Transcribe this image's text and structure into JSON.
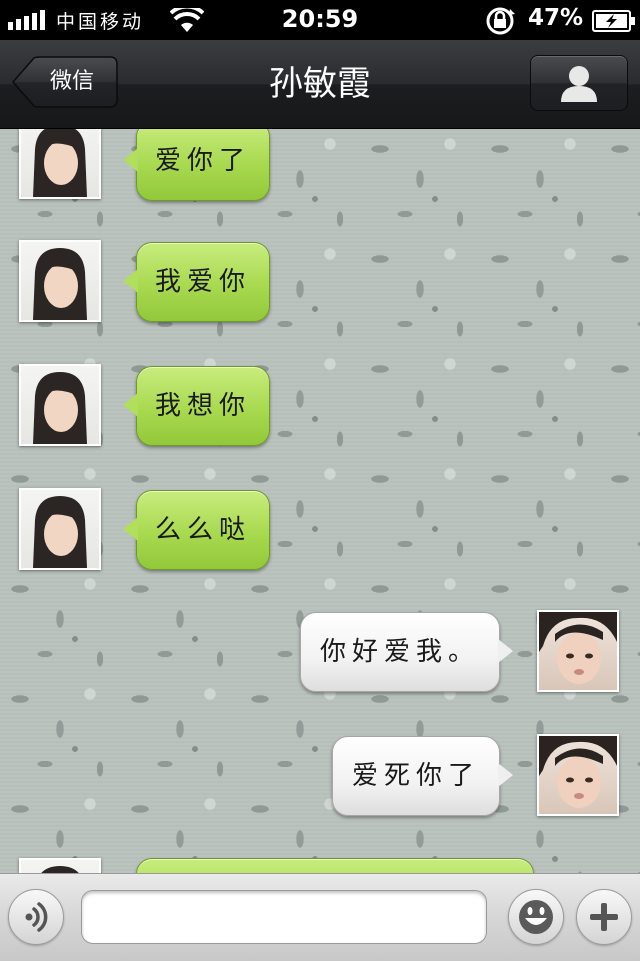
{
  "status_bar": {
    "carrier": "中国移动",
    "time": "20:59",
    "battery_percent": "47%",
    "icons": [
      "signal-bars-icon",
      "wifi-icon",
      "rotation-lock-icon",
      "battery-charging-icon"
    ]
  },
  "nav": {
    "back_label": "微信",
    "title": "孙敏霞",
    "right_icon": "person-icon"
  },
  "messages": [
    {
      "side": "left",
      "text": "爱你了"
    },
    {
      "side": "left",
      "text": "我爱你"
    },
    {
      "side": "left",
      "text": "我想你"
    },
    {
      "side": "left",
      "text": "么么哒"
    },
    {
      "side": "right",
      "text": "你好爱我。"
    },
    {
      "side": "right",
      "text": "爱死你了"
    },
    {
      "side": "left",
      "text": ""
    }
  ],
  "input_bar": {
    "text_value": "",
    "icons": [
      "voice-icon",
      "emoji-icon",
      "plus-icon"
    ]
  },
  "colors": {
    "bubble_green": "#a8d94f",
    "bubble_white": "#f2f2f2",
    "navbar": "#1c1d1f"
  }
}
